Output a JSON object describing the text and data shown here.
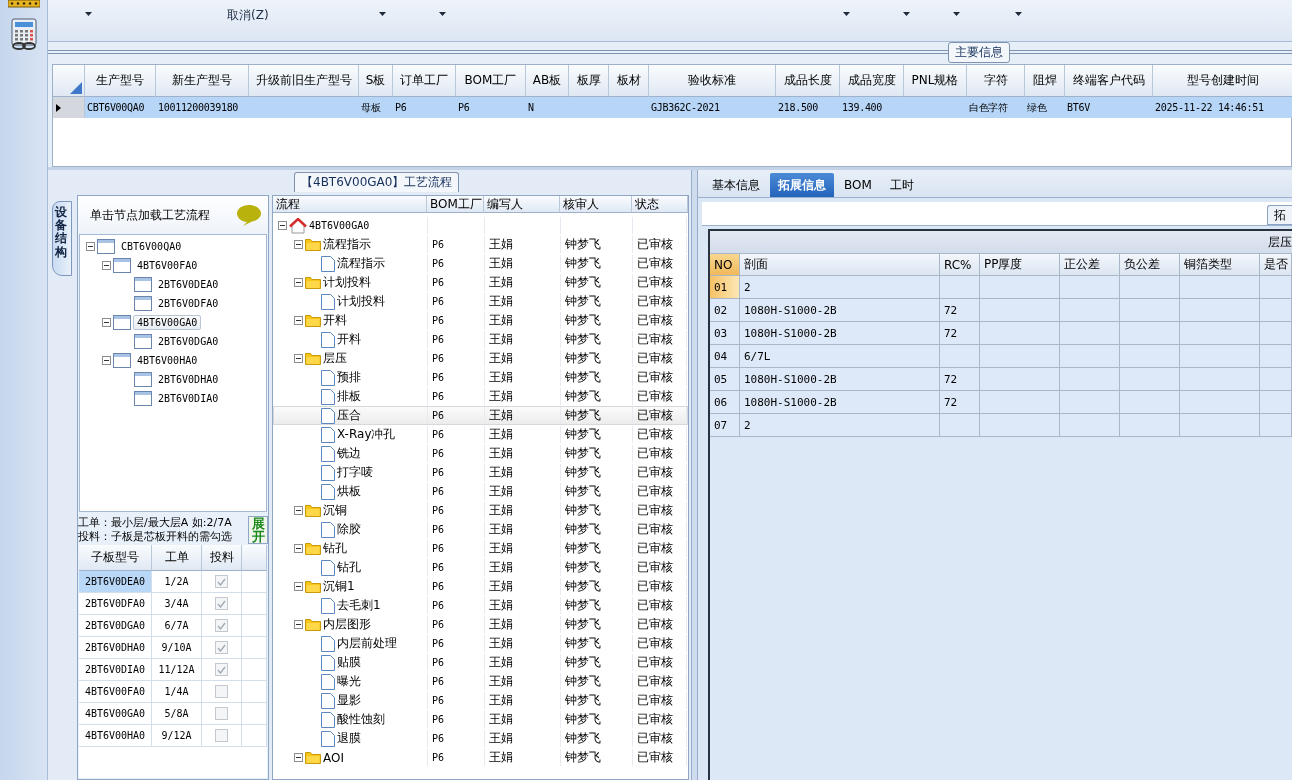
{
  "toolbar": {
    "cancel": "取消(Z)"
  },
  "main_info": {
    "title": "主要信息",
    "columns": [
      "生产型号",
      "新生产型号",
      "升级前旧生产型号",
      "S板",
      "订单工厂",
      "BOM工厂",
      "AB板",
      "板厚",
      "板材",
      "验收标准",
      "成品长度",
      "成品宽度",
      "PNL规格",
      "字符",
      "阻焊",
      "终端客户代码",
      "型号创建时间"
    ],
    "rows": [
      {
        "selected": true,
        "cells": [
          "CBT6V00QA0",
          "10011200039180",
          null,
          "母板",
          "P6",
          "P6",
          "N",
          null,
          null,
          "GJB362C-2021",
          "218.500",
          "139.400",
          null,
          "白色字符",
          "绿色",
          "BT6V",
          "2025-11-22 14:46:51"
        ]
      }
    ]
  },
  "process_flow": {
    "title": "【4BT6V00GA0】工艺流程",
    "side_tab": "设备结构",
    "structure": {
      "header": "单击节点加载工艺流程",
      "tree": [
        {
          "label": "CBT6V00QA0",
          "selected": false,
          "expanded": true,
          "children": [
            {
              "label": "4BT6V00FA0",
              "selected": false,
              "expanded": true,
              "children": [
                {
                  "label": "2BT6V0DEA0",
                  "selected": false
                },
                {
                  "label": "2BT6V0DFA0",
                  "selected": false
                }
              ]
            },
            {
              "label": "4BT6V00GA0",
              "selected": true,
              "expanded": true,
              "children": [
                {
                  "label": "2BT6V0DGA0",
                  "selected": false
                }
              ]
            },
            {
              "label": "4BT6V00HA0",
              "selected": false,
              "expanded": true,
              "children": [
                {
                  "label": "2BT6V0DHA0",
                  "selected": false
                },
                {
                  "label": "2BT6V0DIA0",
                  "selected": false
                }
              ]
            }
          ]
        }
      ]
    },
    "notes": [
      "工单：最小层/最大层A 如:2/7A",
      "投料：子板是芯板开料的需勾选"
    ],
    "expand_button": "展开",
    "sub_boards": {
      "columns": [
        "子板型号",
        "工单",
        "投料"
      ],
      "rows": [
        {
          "model": "2BT6V0DEA0",
          "order": "1/2A",
          "checked": true,
          "selected": true
        },
        {
          "model": "2BT6V0DFA0",
          "order": "3/4A",
          "checked": true,
          "selected": false
        },
        {
          "model": "2BT6V0DGA0",
          "order": "6/7A",
          "checked": true,
          "selected": false
        },
        {
          "model": "2BT6V0DHA0",
          "order": "9/10A",
          "checked": true,
          "selected": false
        },
        {
          "model": "2BT6V0DIA0",
          "order": "11/12A",
          "checked": true,
          "selected": false
        },
        {
          "model": "4BT6V00FA0",
          "order": "1/4A",
          "checked": false,
          "selected": false
        },
        {
          "model": "4BT6V00GA0",
          "order": "5/8A",
          "checked": false,
          "selected": false
        },
        {
          "model": "4BT6V00HA0",
          "order": "9/12A",
          "checked": false,
          "selected": false
        }
      ]
    },
    "flow_tree": {
      "columns": [
        "流程",
        "BOM工厂",
        "编写人",
        "核审人",
        "状态"
      ],
      "root": {
        "kind": "root",
        "label": "4BT6V00GA0",
        "selected": false,
        "expanded": true,
        "children": [
          {
            "kind": "folder",
            "label": "流程指示",
            "bom": "P6",
            "writer": "王娟",
            "reviewer": "钟梦飞",
            "status": "已审核",
            "selected": false,
            "expanded": true,
            "children": [
              {
                "kind": "step",
                "label": "流程指示",
                "bom": "P6",
                "writer": "王娟",
                "reviewer": "钟梦飞",
                "status": "已审核",
                "selected": false
              }
            ]
          },
          {
            "kind": "folder",
            "label": "计划投料",
            "bom": "P6",
            "writer": "王娟",
            "reviewer": "钟梦飞",
            "status": "已审核",
            "selected": false,
            "expanded": true,
            "children": [
              {
                "kind": "step",
                "label": "计划投料",
                "bom": "P6",
                "writer": "王娟",
                "reviewer": "钟梦飞",
                "status": "已审核",
                "selected": false
              }
            ]
          },
          {
            "kind": "folder",
            "label": "开料",
            "bom": "P6",
            "writer": "王娟",
            "reviewer": "钟梦飞",
            "status": "已审核",
            "selected": false,
            "expanded": true,
            "children": [
              {
                "kind": "step",
                "label": "开料",
                "bom": "P6",
                "writer": "王娟",
                "reviewer": "钟梦飞",
                "status": "已审核",
                "selected": false
              }
            ]
          },
          {
            "kind": "folder",
            "label": "层压",
            "bom": "P6",
            "writer": "王娟",
            "reviewer": "钟梦飞",
            "status": "已审核",
            "selected": false,
            "expanded": true,
            "children": [
              {
                "kind": "step",
                "label": "预排",
                "bom": "P6",
                "writer": "王娟",
                "reviewer": "钟梦飞",
                "status": "已审核",
                "selected": false
              },
              {
                "kind": "step",
                "label": "排板",
                "bom": "P6",
                "writer": "王娟",
                "reviewer": "钟梦飞",
                "status": "已审核",
                "selected": false
              },
              {
                "kind": "step",
                "label": "压合",
                "bom": "P6",
                "writer": "王娟",
                "reviewer": "钟梦飞",
                "status": "已审核",
                "selected": true
              },
              {
                "kind": "step",
                "label": "X-Ray冲孔",
                "bom": "P6",
                "writer": "王娟",
                "reviewer": "钟梦飞",
                "status": "已审核",
                "selected": false
              },
              {
                "kind": "step",
                "label": "铣边",
                "bom": "P6",
                "writer": "王娟",
                "reviewer": "钟梦飞",
                "status": "已审核",
                "selected": false
              },
              {
                "kind": "step",
                "label": "打字唛",
                "bom": "P6",
                "writer": "王娟",
                "reviewer": "钟梦飞",
                "status": "已审核",
                "selected": false
              },
              {
                "kind": "step",
                "label": "烘板",
                "bom": "P6",
                "writer": "王娟",
                "reviewer": "钟梦飞",
                "status": "已审核",
                "selected": false
              }
            ]
          },
          {
            "kind": "folder",
            "label": "沉铜",
            "bom": "P6",
            "writer": "王娟",
            "reviewer": "钟梦飞",
            "status": "已审核",
            "selected": false,
            "expanded": true,
            "children": [
              {
                "kind": "step",
                "label": "除胶",
                "bom": "P6",
                "writer": "王娟",
                "reviewer": "钟梦飞",
                "status": "已审核",
                "selected": false
              }
            ]
          },
          {
            "kind": "folder",
            "label": "钻孔",
            "bom": "P6",
            "writer": "王娟",
            "reviewer": "钟梦飞",
            "status": "已审核",
            "selected": false,
            "expanded": true,
            "children": [
              {
                "kind": "step",
                "label": "钻孔",
                "bom": "P6",
                "writer": "王娟",
                "reviewer": "钟梦飞",
                "status": "已审核",
                "selected": false
              }
            ]
          },
          {
            "kind": "folder",
            "label": "沉铜1",
            "bom": "P6",
            "writer": "王娟",
            "reviewer": "钟梦飞",
            "status": "已审核",
            "selected": false,
            "expanded": true,
            "children": [
              {
                "kind": "step",
                "label": "去毛刺1",
                "bom": "P6",
                "writer": "王娟",
                "reviewer": "钟梦飞",
                "status": "已审核",
                "selected": false
              }
            ]
          },
          {
            "kind": "folder",
            "label": "内层图形",
            "bom": "P6",
            "writer": "王娟",
            "reviewer": "钟梦飞",
            "status": "已审核",
            "selected": false,
            "expanded": true,
            "children": [
              {
                "kind": "step",
                "label": "内层前处理",
                "bom": "P6",
                "writer": "王娟",
                "reviewer": "钟梦飞",
                "status": "已审核",
                "selected": false
              },
              {
                "kind": "step",
                "label": "贴膜",
                "bom": "P6",
                "writer": "王娟",
                "reviewer": "钟梦飞",
                "status": "已审核",
                "selected": false
              },
              {
                "kind": "step",
                "label": "曝光",
                "bom": "P6",
                "writer": "王娟",
                "reviewer": "钟梦飞",
                "status": "已审核",
                "selected": false
              },
              {
                "kind": "step",
                "label": "显影",
                "bom": "P6",
                "writer": "王娟",
                "reviewer": "钟梦飞",
                "status": "已审核",
                "selected": false
              },
              {
                "kind": "step",
                "label": "酸性蚀刻",
                "bom": "P6",
                "writer": "王娟",
                "reviewer": "钟梦飞",
                "status": "已审核",
                "selected": false
              },
              {
                "kind": "step",
                "label": "退膜",
                "bom": "P6",
                "writer": "王娟",
                "reviewer": "钟梦飞",
                "status": "已审核",
                "selected": false
              }
            ]
          },
          {
            "kind": "folder",
            "label": "AOI",
            "bom": "P6",
            "writer": "王娟",
            "reviewer": "钟梦飞",
            "status": "已审核",
            "selected": false,
            "expanded": true
          }
        ]
      }
    }
  },
  "details": {
    "tabs": [
      {
        "label": "基本信息",
        "selected": false
      },
      {
        "label": "拓展信息",
        "selected": true
      },
      {
        "label": "BOM",
        "selected": false
      },
      {
        "label": "工时",
        "selected": false
      }
    ],
    "sub_tab": "拓",
    "stack": {
      "group_title": "层压",
      "columns": [
        "NO",
        "剖面",
        "RC%",
        "PP厚度",
        "正公差",
        "负公差",
        "铜箔类型",
        "是否"
      ],
      "rows": [
        {
          "no": "01",
          "section": "2",
          "selected": true
        },
        {
          "no": "02",
          "section": "1080H-S1000-2B",
          "rc": "72",
          "selected": false
        },
        {
          "no": "03",
          "section": "1080H-S1000-2B",
          "rc": "72",
          "selected": false
        },
        {
          "no": "04",
          "section": "6/7L",
          "selected": false
        },
        {
          "no": "05",
          "section": "1080H-S1000-2B",
          "rc": "72",
          "selected": false
        },
        {
          "no": "06",
          "section": "1080H-S1000-2B",
          "rc": "72",
          "selected": false
        },
        {
          "no": "07",
          "section": "2",
          "selected": false
        }
      ]
    }
  }
}
